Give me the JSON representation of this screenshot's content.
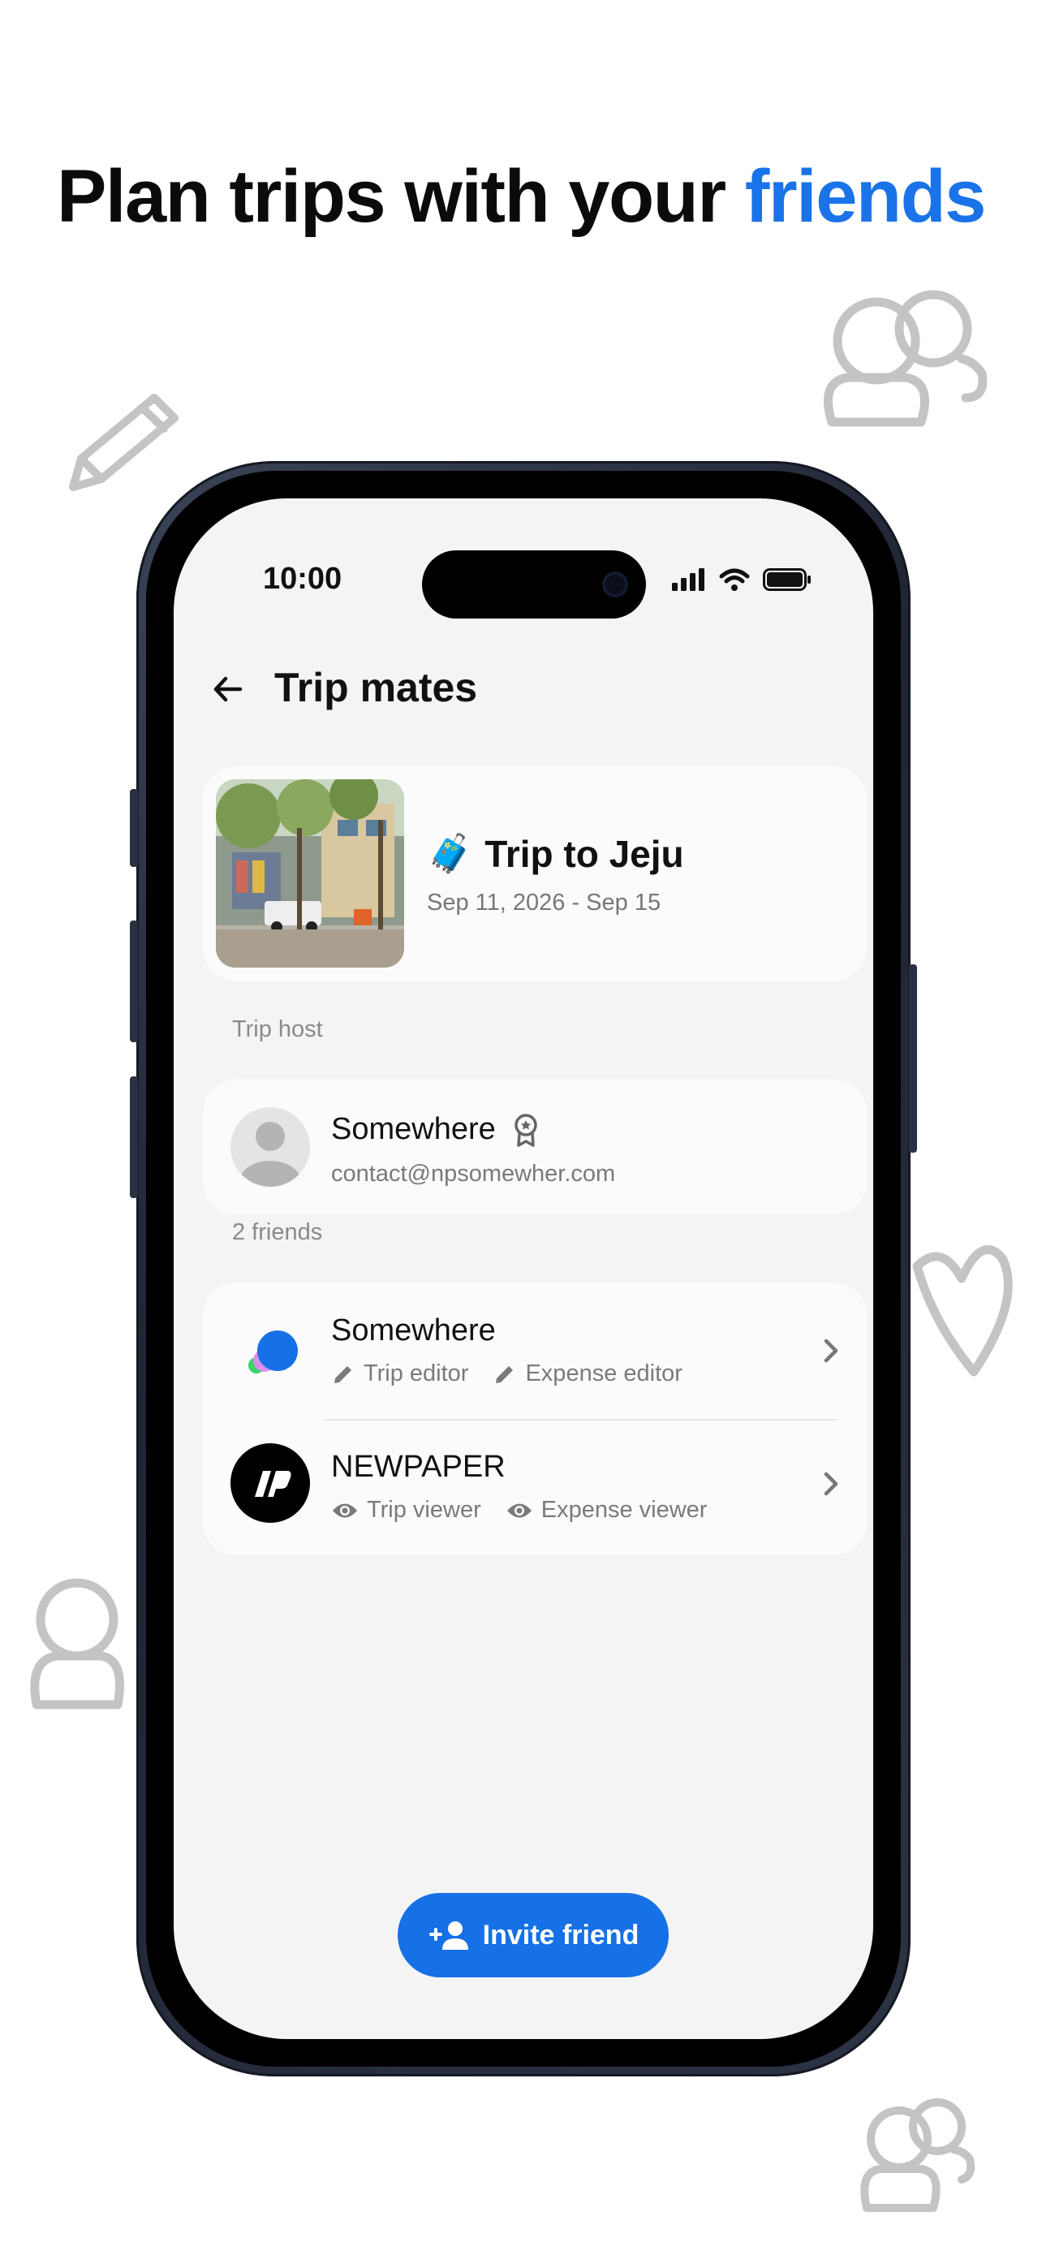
{
  "headline": {
    "main": "Plan trips with your",
    "accent": "friends"
  },
  "colors": {
    "accent": "#1a73e8",
    "button": "#1670e6",
    "screen_bg": "#f4f4f4",
    "card_bg": "#fbfbfb"
  },
  "status_bar": {
    "time": "10:00",
    "icons": [
      "signal-icon",
      "wifi-icon",
      "battery-icon"
    ]
  },
  "header": {
    "title": "Trip mates",
    "back_icon": "back-arrow-icon"
  },
  "trip": {
    "emoji": "🧳",
    "title": "Trip to Jeju",
    "dates": "Sep 11, 2026 - Sep 15"
  },
  "host_section": {
    "label": "Trip host",
    "host": {
      "name": "Somewhere",
      "email": "contact@npsomewher.com",
      "badge_icon": "host-badge-icon"
    }
  },
  "friends_section": {
    "label": "2 friends",
    "friends": [
      {
        "name": "Somewhere",
        "permissions": [
          "Trip editor",
          "Expense editor"
        ],
        "perm_icon": "pencil-icon"
      },
      {
        "name": "NEWPAPER",
        "permissions": [
          "Trip viewer",
          "Expense viewer"
        ],
        "perm_icon": "eye-icon"
      }
    ]
  },
  "invite_button": {
    "label": "Invite friend",
    "icon": "add-person-icon"
  }
}
